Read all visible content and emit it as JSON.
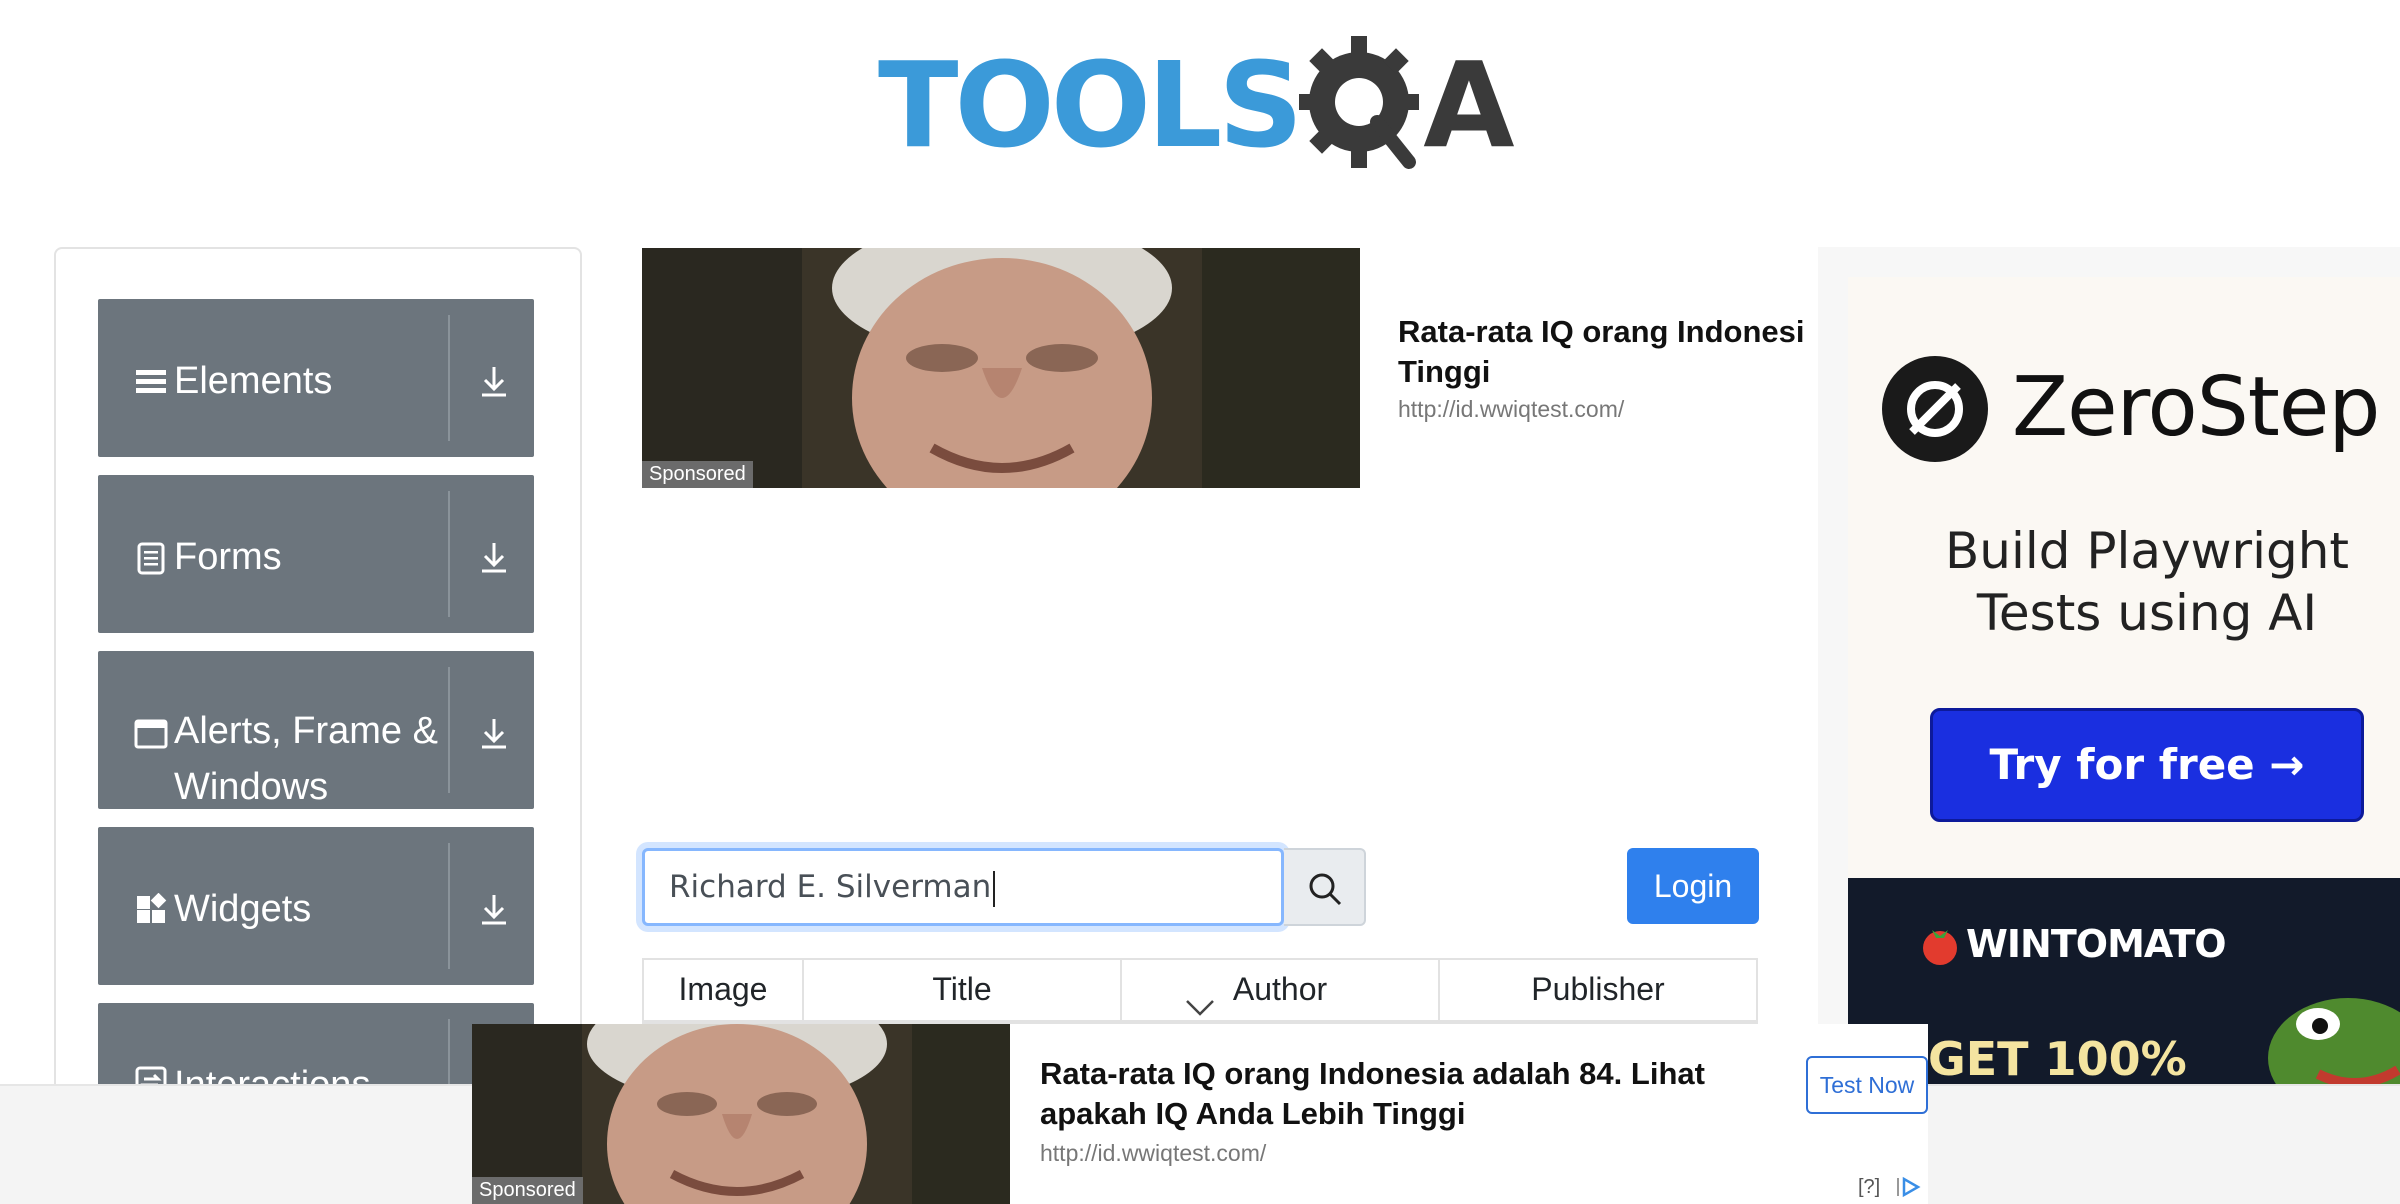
{
  "logo": {
    "text_left": "TOOLS",
    "text_right": "A"
  },
  "sidebar": {
    "groups": [
      {
        "label": "Elements",
        "icon": "menu-icon"
      },
      {
        "label": "Forms",
        "icon": "form-icon"
      },
      {
        "label": "Alerts, Frame &",
        "label2": "Windows",
        "icon": "window-icon"
      },
      {
        "label": "Widgets",
        "icon": "widgets-icon"
      },
      {
        "label": "Interactions",
        "icon": "interactions-icon"
      }
    ]
  },
  "ad_top": {
    "title_line1": "Rata-rata IQ orang Indonesi",
    "title_line2": "Tinggi",
    "url": "http://id.wwiqtest.com/",
    "sponsored": "Sponsored"
  },
  "search": {
    "value": "Richard E. Silverman"
  },
  "login": {
    "label": "Login"
  },
  "table": {
    "headers": [
      "Image",
      "Title",
      "Author",
      "Publisher"
    ]
  },
  "right_ad": {
    "brand": "ZeroStep",
    "tagline_line1": "Build Playwright",
    "tagline_line2": "Tests using AI",
    "cta": "Try for free →",
    "brand2": "WINTOMATO",
    "promo": "GET 100%"
  },
  "bottom_ad": {
    "title": "Rata-rata IQ orang Indonesia adalah 84. Lihat apakah IQ Anda Lebih Tinggi",
    "url": "http://id.wwiqtest.com/",
    "sponsored": "Sponsored",
    "cta": "Test Now",
    "adchoice": "[?]"
  },
  "colors": {
    "sidebar_group": "#6c757d",
    "primary": "#2f80ed",
    "logo_blue": "#3b9ad9",
    "cta_blue": "#1a2fe0"
  }
}
